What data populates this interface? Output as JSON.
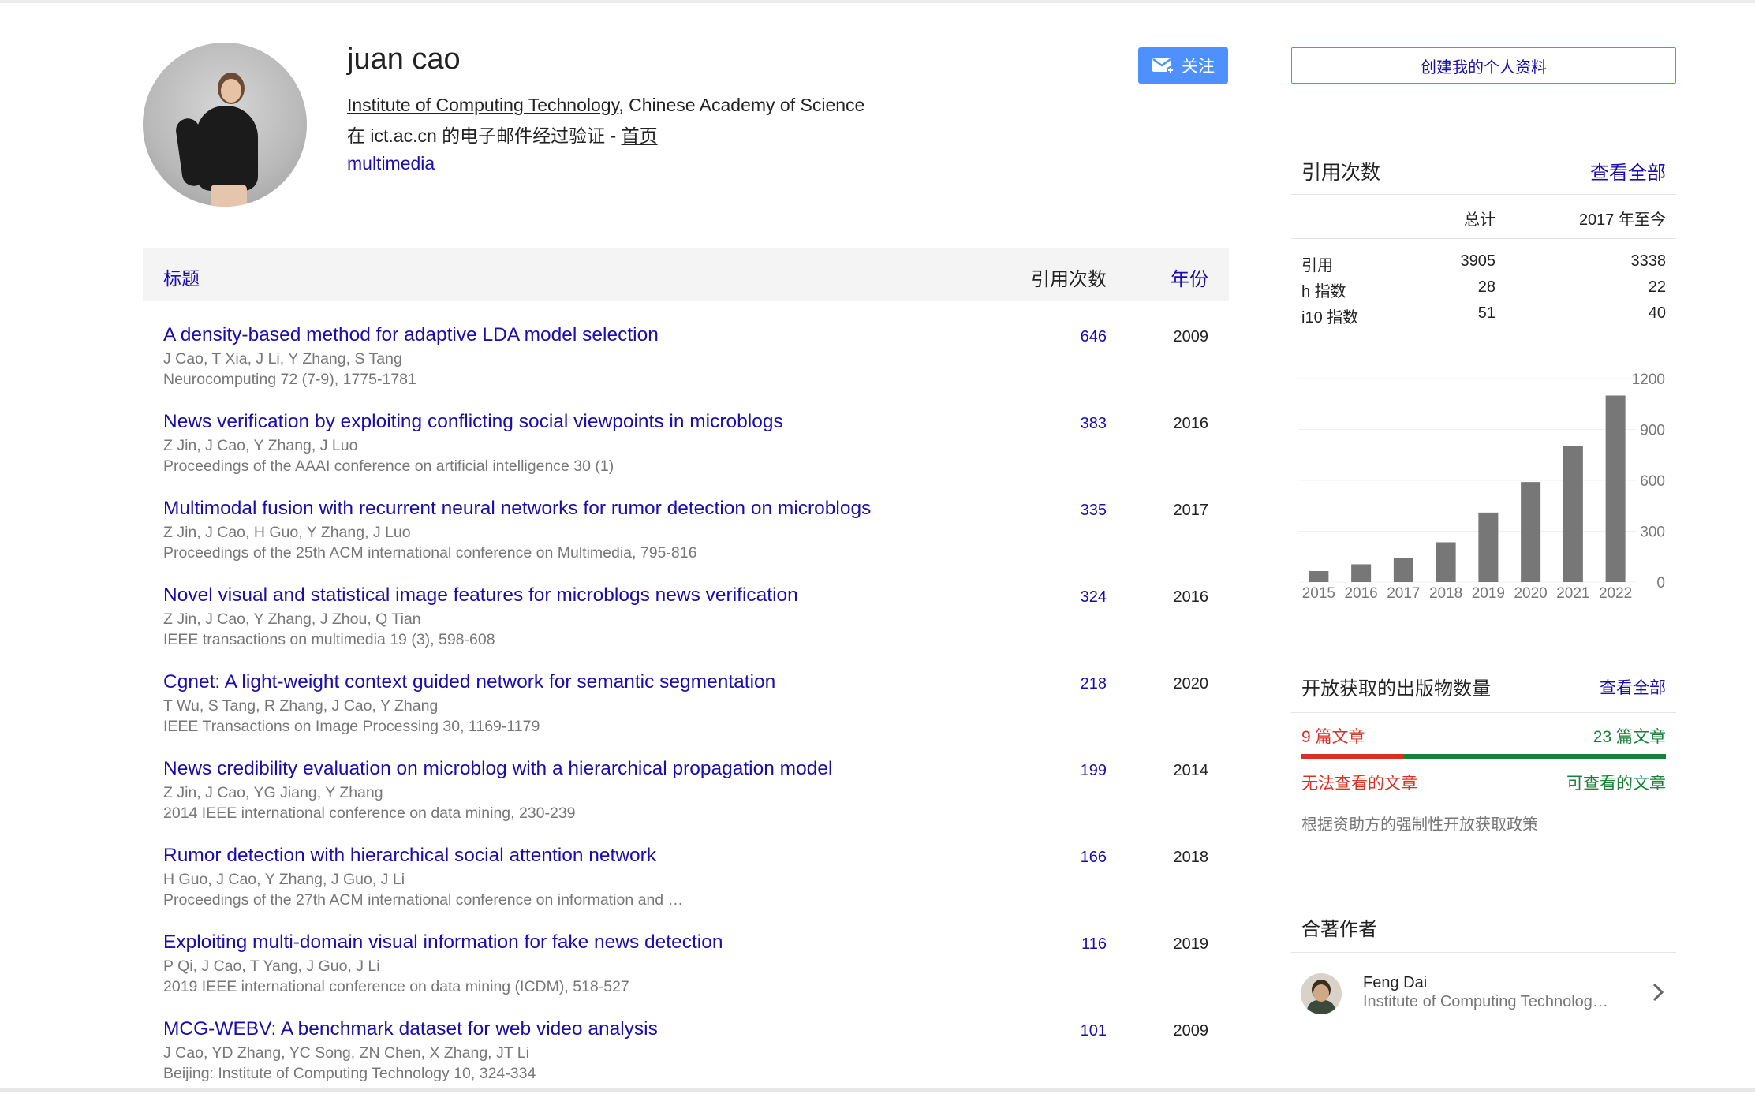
{
  "profile": {
    "name": "juan cao",
    "affiliation_link": "Institute of Computing Technology",
    "affiliation_rest": ", Chinese Academy of Science",
    "email_text": "在 ict.ac.cn 的电子邮件经过验证 - ",
    "homepage_label": "首页",
    "interest": "multimedia",
    "follow_label": "关注"
  },
  "table": {
    "header_title": "标题",
    "header_citations": "引用次数",
    "header_year": "年份",
    "rows": [
      {
        "title": "A density-based method for adaptive LDA model selection",
        "authors": "J Cao, T Xia, J Li, Y Zhang, S Tang",
        "venue": "Neurocomputing 72 (7-9), 1775-1781",
        "citations": "646",
        "year": "2009"
      },
      {
        "title": "News verification by exploiting conflicting social viewpoints in microblogs",
        "authors": "Z Jin, J Cao, Y Zhang, J Luo",
        "venue": "Proceedings of the AAAI conference on artificial intelligence 30 (1)",
        "citations": "383",
        "year": "2016"
      },
      {
        "title": "Multimodal fusion with recurrent neural networks for rumor detection on microblogs",
        "authors": "Z Jin, J Cao, H Guo, Y Zhang, J Luo",
        "venue": "Proceedings of the 25th ACM international conference on Multimedia, 795-816",
        "citations": "335",
        "year": "2017"
      },
      {
        "title": "Novel visual and statistical image features for microblogs news verification",
        "authors": "Z Jin, J Cao, Y Zhang, J Zhou, Q Tian",
        "venue": "IEEE transactions on multimedia 19 (3), 598-608",
        "citations": "324",
        "year": "2016"
      },
      {
        "title": "Cgnet: A light-weight context guided network for semantic segmentation",
        "authors": "T Wu, S Tang, R Zhang, J Cao, Y Zhang",
        "venue": "IEEE Transactions on Image Processing 30, 1169-1179",
        "citations": "218",
        "year": "2020"
      },
      {
        "title": "News credibility evaluation on microblog with a hierarchical propagation model",
        "authors": "Z Jin, J Cao, YG Jiang, Y Zhang",
        "venue": "2014 IEEE international conference on data mining, 230-239",
        "citations": "199",
        "year": "2014"
      },
      {
        "title": "Rumor detection with hierarchical social attention network",
        "authors": "H Guo, J Cao, Y Zhang, J Guo, J Li",
        "venue": "Proceedings of the 27th ACM international conference on information and …",
        "citations": "166",
        "year": "2018"
      },
      {
        "title": "Exploiting multi-domain visual information for fake news detection",
        "authors": "P Qi, J Cao, T Yang, J Guo, J Li",
        "venue": "2019 IEEE international conference on data mining (ICDM), 518-527",
        "citations": "116",
        "year": "2019"
      },
      {
        "title": "MCG-WEBV: A benchmark dataset for web video analysis",
        "authors": "J Cao, YD Zhang, YC Song, ZN Chen, X Zhang, JT Li",
        "venue": "Beijing: Institute of Computing Technology 10, 324-334",
        "citations": "101",
        "year": "2009"
      }
    ]
  },
  "sidebar": {
    "create_profile": "创建我的个人资料",
    "citations_heading": "引用次数",
    "view_all": "查看全部",
    "col_total": "总计",
    "col_since": "2017 年至今",
    "stats": [
      {
        "label": "引用",
        "total": "3905",
        "since": "3338"
      },
      {
        "label": "h 指数",
        "total": "28",
        "since": "22"
      },
      {
        "label": "i10 指数",
        "total": "51",
        "since": "40"
      }
    ],
    "open_access_heading": "开放获取的出版物数量",
    "open_access_view_all": "查看全部",
    "oa_unavailable_count": "9 篇文章",
    "oa_available_count": "23 篇文章",
    "oa_unavailable_label": "无法查看的文章",
    "oa_available_label": "可查看的文章",
    "oa_note": "根据资助方的强制性开放获取政策",
    "coauthors_heading": "合著作者",
    "coauthors": [
      {
        "name": "Feng Dai",
        "affiliation": "Institute of Computing Technolog…"
      }
    ],
    "colors": {
      "unavailable": "#d93025",
      "available": "#188038",
      "link": "#1a0dab",
      "button": "#4d90fe",
      "bar": "#777777"
    }
  },
  "chart_data": {
    "type": "bar",
    "categories": [
      "2015",
      "2016",
      "2017",
      "2018",
      "2019",
      "2020",
      "2021",
      "2022"
    ],
    "values": [
      65,
      105,
      140,
      235,
      410,
      590,
      800,
      1100
    ],
    "yticks": [
      "0",
      "300",
      "600",
      "900",
      "1200"
    ],
    "ylim": [
      0,
      1200
    ],
    "grid": true
  }
}
